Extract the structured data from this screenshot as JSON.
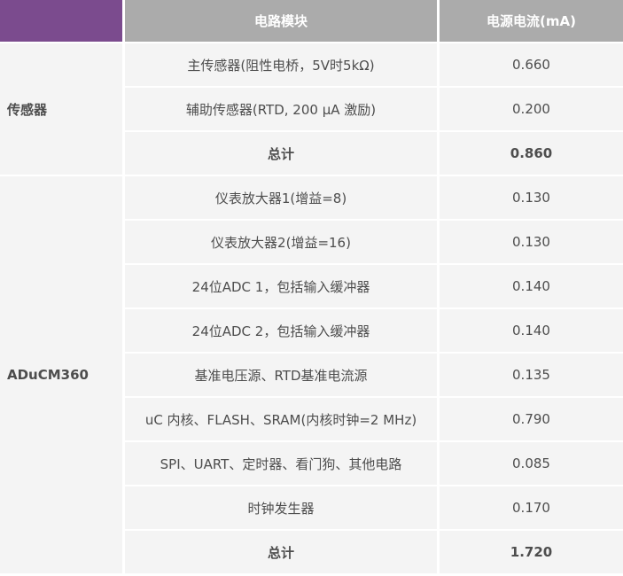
{
  "table": {
    "header": {
      "corner_label": "",
      "module_label": "电路模块",
      "current_label": "电源电流(mA)"
    },
    "groups": [
      {
        "label": "传感器",
        "row_span": 3
      },
      {
        "label": "ADuCM360",
        "row_span": 9
      }
    ],
    "rows": [
      {
        "group": "传感器",
        "module": "主传感器(阻性电桥，5V时5kΩ)",
        "current": "0.660",
        "bold": false
      },
      {
        "group": "传感器",
        "module": "辅助传感器(RTD, 200 μA 激励)",
        "current": "0.200",
        "bold": false
      },
      {
        "group": "传感器",
        "module": "总计",
        "current": "0.860",
        "bold": true
      },
      {
        "group": "ADuCM360",
        "module": "仪表放大器1(增益=8)",
        "current": "0.130",
        "bold": false
      },
      {
        "group": "ADuCM360",
        "module": "仪表放大器2(增益=16)",
        "current": "0.130",
        "bold": false
      },
      {
        "group": "ADuCM360",
        "module": "24位ADC 1，包括输入缓冲器",
        "current": "0.140",
        "bold": false
      },
      {
        "group": "ADuCM360",
        "module": "24位ADC 2，包括输入缓冲器",
        "current": "0.140",
        "bold": false
      },
      {
        "group": "ADuCM360",
        "module": "基准电压源、RTD基准电流源",
        "current": "0.135",
        "bold": false
      },
      {
        "group": "ADuCM360",
        "module": "uC 内核、FLASH、SRAM(内核时钟=2 MHz)",
        "current": "0.790",
        "bold": false
      },
      {
        "group": "ADuCM360",
        "module": "SPI、UART、定时器、看门狗、其他电路",
        "current": "0.085",
        "bold": false
      },
      {
        "group": "ADuCM360",
        "module": "时钟发生器",
        "current": "0.170",
        "bold": false
      },
      {
        "group": "ADuCM360",
        "module": "总计",
        "current": "1.720",
        "bold": true
      }
    ]
  },
  "colors": {
    "accent_purple": "#7b4b8e",
    "header_gray": "#ababab",
    "row_background": "#f4f4f4",
    "text": "#4d4d4d",
    "header_text": "#ffffff",
    "separator": "#ffffff"
  },
  "chart_data": {
    "type": "table",
    "columns": [
      "",
      "电路模块",
      "电源电流(mA)"
    ],
    "row_groups": [
      {
        "group": "传感器",
        "rows": [
          [
            "主传感器(阻性电桥，5V时5kΩ)",
            0.66
          ],
          [
            "辅助传感器(RTD, 200 μA 激励)",
            0.2
          ],
          [
            "总计",
            0.86
          ]
        ]
      },
      {
        "group": "ADuCM360",
        "rows": [
          [
            "仪表放大器1(增益=8)",
            0.13
          ],
          [
            "仪表放大器2(增益=16)",
            0.13
          ],
          [
            "24位ADC 1，包括输入缓冲器",
            0.14
          ],
          [
            "24位ADC 2，包括输入缓冲器",
            0.14
          ],
          [
            "基准电压源、RTD基准电流源",
            0.135
          ],
          [
            "uC 内核、FLASH、SRAM(内核时钟=2 MHz)",
            0.79
          ],
          [
            "SPI、UART、定时器、看门狗、其他电路",
            0.085
          ],
          [
            "时钟发生器",
            0.17
          ],
          [
            "总计",
            1.72
          ]
        ]
      }
    ],
    "totals": {
      "传感器": 0.86,
      "ADuCM360": 1.72
    },
    "units": "mA"
  }
}
